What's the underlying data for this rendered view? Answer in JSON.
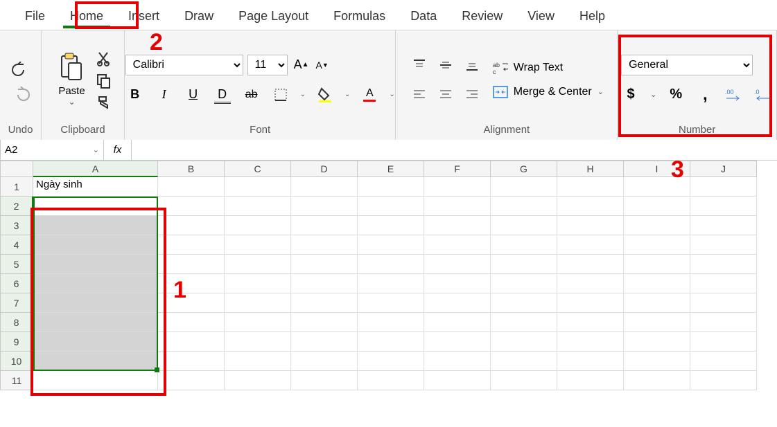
{
  "tabs": [
    "File",
    "Home",
    "Insert",
    "Draw",
    "Page Layout",
    "Formulas",
    "Data",
    "Review",
    "View",
    "Help"
  ],
  "active_tab": "Home",
  "ribbon": {
    "undo_label": "Undo",
    "clipboard": {
      "paste": "Paste",
      "label": "Clipboard"
    },
    "font": {
      "name": "Calibri",
      "size": "11",
      "label": "Font"
    },
    "alignment": {
      "wrap": "Wrap Text",
      "merge": "Merge & Center",
      "label": "Alignment"
    },
    "number": {
      "format": "General",
      "label": "Number"
    }
  },
  "name_box": "A2",
  "fx_label": "fx",
  "columns": [
    "A",
    "B",
    "C",
    "D",
    "E",
    "F",
    "G",
    "H",
    "I",
    "J"
  ],
  "rows": [
    "1",
    "2",
    "3",
    "4",
    "5",
    "6",
    "7",
    "8",
    "9",
    "10",
    "11"
  ],
  "cells": {
    "A1": "Ngày sinh"
  },
  "selection": {
    "col": "A",
    "rows_from": 2,
    "rows_to": 10
  },
  "annotations": {
    "one": "1",
    "two": "2",
    "three": "3"
  },
  "chevron": "⌄"
}
